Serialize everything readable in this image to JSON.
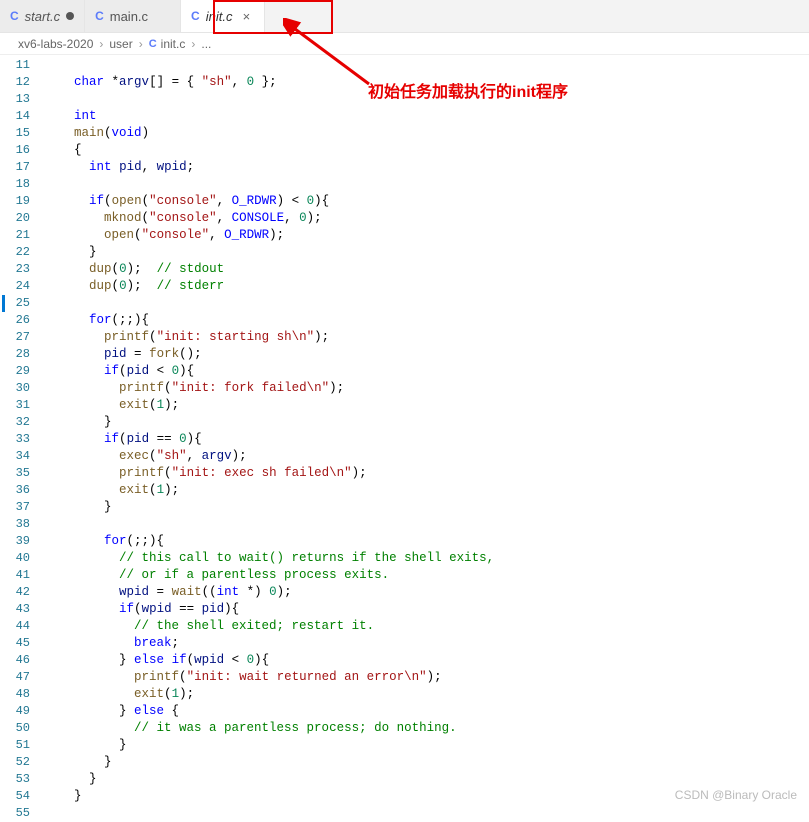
{
  "tabs": [
    {
      "icon": "C",
      "name": "start.c",
      "italic": true,
      "dirty": true,
      "active": false
    },
    {
      "icon": "C",
      "name": "main.c",
      "italic": false,
      "dirty": false,
      "active": false
    },
    {
      "icon": "C",
      "name": "init.c",
      "italic": true,
      "dirty": false,
      "active": true
    }
  ],
  "breadcrumbs": {
    "parts": [
      "xv6-labs-2020",
      "user",
      "init.c",
      "..."
    ],
    "file_icon": "C"
  },
  "annotation": {
    "text": "初始任务加载执行的init程序"
  },
  "modified_ranges": [
    [
      25,
      25
    ]
  ],
  "line_start": 11,
  "line_end": 55,
  "code_lines": [
    [],
    [
      [
        "kw",
        "char"
      ],
      [
        "op",
        " *"
      ],
      [
        "var",
        "argv"
      ],
      [
        "op",
        "[] = { "
      ],
      [
        "str",
        "\"sh\""
      ],
      [
        "op",
        ", "
      ],
      [
        "num",
        "0"
      ],
      [
        "op",
        " };"
      ]
    ],
    [],
    [
      [
        "kw",
        "int"
      ]
    ],
    [
      [
        "fn",
        "main"
      ],
      [
        "op",
        "("
      ],
      [
        "kw",
        "void"
      ],
      [
        "op",
        ")"
      ]
    ],
    [
      [
        "op",
        "{"
      ]
    ],
    [
      [
        "op",
        "  "
      ],
      [
        "kw",
        "int"
      ],
      [
        "op",
        " "
      ],
      [
        "var",
        "pid"
      ],
      [
        "op",
        ", "
      ],
      [
        "var",
        "wpid"
      ],
      [
        "op",
        ";"
      ]
    ],
    [],
    [
      [
        "op",
        "  "
      ],
      [
        "kw",
        "if"
      ],
      [
        "op",
        "("
      ],
      [
        "fn",
        "open"
      ],
      [
        "op",
        "("
      ],
      [
        "str",
        "\"console\""
      ],
      [
        "op",
        ", "
      ],
      [
        "mac",
        "O_RDWR"
      ],
      [
        "op",
        ") < "
      ],
      [
        "num",
        "0"
      ],
      [
        "op",
        "){"
      ]
    ],
    [
      [
        "op",
        "    "
      ],
      [
        "fn",
        "mknod"
      ],
      [
        "op",
        "("
      ],
      [
        "str",
        "\"console\""
      ],
      [
        "op",
        ", "
      ],
      [
        "mac",
        "CONSOLE"
      ],
      [
        "op",
        ", "
      ],
      [
        "num",
        "0"
      ],
      [
        "op",
        ");"
      ]
    ],
    [
      [
        "op",
        "    "
      ],
      [
        "fn",
        "open"
      ],
      [
        "op",
        "("
      ],
      [
        "str",
        "\"console\""
      ],
      [
        "op",
        ", "
      ],
      [
        "mac",
        "O_RDWR"
      ],
      [
        "op",
        ");"
      ]
    ],
    [
      [
        "op",
        "  }"
      ]
    ],
    [
      [
        "op",
        "  "
      ],
      [
        "fn",
        "dup"
      ],
      [
        "op",
        "("
      ],
      [
        "num",
        "0"
      ],
      [
        "op",
        ");  "
      ],
      [
        "cmt",
        "// stdout"
      ]
    ],
    [
      [
        "op",
        "  "
      ],
      [
        "fn",
        "dup"
      ],
      [
        "op",
        "("
      ],
      [
        "num",
        "0"
      ],
      [
        "op",
        ");  "
      ],
      [
        "cmt",
        "// stderr"
      ]
    ],
    [],
    [
      [
        "op",
        "  "
      ],
      [
        "kw",
        "for"
      ],
      [
        "op",
        "(;;){"
      ]
    ],
    [
      [
        "op",
        "    "
      ],
      [
        "fn",
        "printf"
      ],
      [
        "op",
        "("
      ],
      [
        "str",
        "\"init: starting sh\\n\""
      ],
      [
        "op",
        ");"
      ]
    ],
    [
      [
        "op",
        "    "
      ],
      [
        "var",
        "pid"
      ],
      [
        "op",
        " = "
      ],
      [
        "fn",
        "fork"
      ],
      [
        "op",
        "();"
      ]
    ],
    [
      [
        "op",
        "    "
      ],
      [
        "kw",
        "if"
      ],
      [
        "op",
        "("
      ],
      [
        "var",
        "pid"
      ],
      [
        "op",
        " < "
      ],
      [
        "num",
        "0"
      ],
      [
        "op",
        "){"
      ]
    ],
    [
      [
        "op",
        "      "
      ],
      [
        "fn",
        "printf"
      ],
      [
        "op",
        "("
      ],
      [
        "str",
        "\"init: fork failed\\n\""
      ],
      [
        "op",
        ");"
      ]
    ],
    [
      [
        "op",
        "      "
      ],
      [
        "fn",
        "exit"
      ],
      [
        "op",
        "("
      ],
      [
        "num",
        "1"
      ],
      [
        "op",
        ");"
      ]
    ],
    [
      [
        "op",
        "    }"
      ]
    ],
    [
      [
        "op",
        "    "
      ],
      [
        "kw",
        "if"
      ],
      [
        "op",
        "("
      ],
      [
        "var",
        "pid"
      ],
      [
        "op",
        " == "
      ],
      [
        "num",
        "0"
      ],
      [
        "op",
        "){"
      ]
    ],
    [
      [
        "op",
        "      "
      ],
      [
        "fn",
        "exec"
      ],
      [
        "op",
        "("
      ],
      [
        "str",
        "\"sh\""
      ],
      [
        "op",
        ", "
      ],
      [
        "var",
        "argv"
      ],
      [
        "op",
        ");"
      ]
    ],
    [
      [
        "op",
        "      "
      ],
      [
        "fn",
        "printf"
      ],
      [
        "op",
        "("
      ],
      [
        "str",
        "\"init: exec sh failed\\n\""
      ],
      [
        "op",
        ");"
      ]
    ],
    [
      [
        "op",
        "      "
      ],
      [
        "fn",
        "exit"
      ],
      [
        "op",
        "("
      ],
      [
        "num",
        "1"
      ],
      [
        "op",
        ");"
      ]
    ],
    [
      [
        "op",
        "    }"
      ]
    ],
    [],
    [
      [
        "op",
        "    "
      ],
      [
        "kw",
        "for"
      ],
      [
        "op",
        "(;;){"
      ]
    ],
    [
      [
        "op",
        "      "
      ],
      [
        "cmt",
        "// this call to wait() returns if the shell exits,"
      ]
    ],
    [
      [
        "op",
        "      "
      ],
      [
        "cmt",
        "// or if a parentless process exits."
      ]
    ],
    [
      [
        "op",
        "      "
      ],
      [
        "var",
        "wpid"
      ],
      [
        "op",
        " = "
      ],
      [
        "fn",
        "wait"
      ],
      [
        "op",
        "(("
      ],
      [
        "kw",
        "int"
      ],
      [
        "op",
        " *) "
      ],
      [
        "num",
        "0"
      ],
      [
        "op",
        ");"
      ]
    ],
    [
      [
        "op",
        "      "
      ],
      [
        "kw",
        "if"
      ],
      [
        "op",
        "("
      ],
      [
        "var",
        "wpid"
      ],
      [
        "op",
        " == "
      ],
      [
        "var",
        "pid"
      ],
      [
        "op",
        "){"
      ]
    ],
    [
      [
        "op",
        "        "
      ],
      [
        "cmt",
        "// the shell exited; restart it."
      ]
    ],
    [
      [
        "op",
        "        "
      ],
      [
        "kw",
        "break"
      ],
      [
        "op",
        ";"
      ]
    ],
    [
      [
        "op",
        "      } "
      ],
      [
        "kw",
        "else"
      ],
      [
        "op",
        " "
      ],
      [
        "kw",
        "if"
      ],
      [
        "op",
        "("
      ],
      [
        "var",
        "wpid"
      ],
      [
        "op",
        " < "
      ],
      [
        "num",
        "0"
      ],
      [
        "op",
        "){"
      ]
    ],
    [
      [
        "op",
        "        "
      ],
      [
        "fn",
        "printf"
      ],
      [
        "op",
        "("
      ],
      [
        "str",
        "\"init: wait returned an error\\n\""
      ],
      [
        "op",
        ");"
      ]
    ],
    [
      [
        "op",
        "        "
      ],
      [
        "fn",
        "exit"
      ],
      [
        "op",
        "("
      ],
      [
        "num",
        "1"
      ],
      [
        "op",
        ");"
      ]
    ],
    [
      [
        "op",
        "      } "
      ],
      [
        "kw",
        "else"
      ],
      [
        "op",
        " {"
      ]
    ],
    [
      [
        "op",
        "        "
      ],
      [
        "cmt",
        "// it was a parentless process; do nothing."
      ]
    ],
    [
      [
        "op",
        "      }"
      ]
    ],
    [
      [
        "op",
        "    }"
      ]
    ],
    [
      [
        "op",
        "  }"
      ]
    ],
    [
      [
        "op",
        "}"
      ]
    ],
    []
  ],
  "watermark": "CSDN @Binary Oracle"
}
